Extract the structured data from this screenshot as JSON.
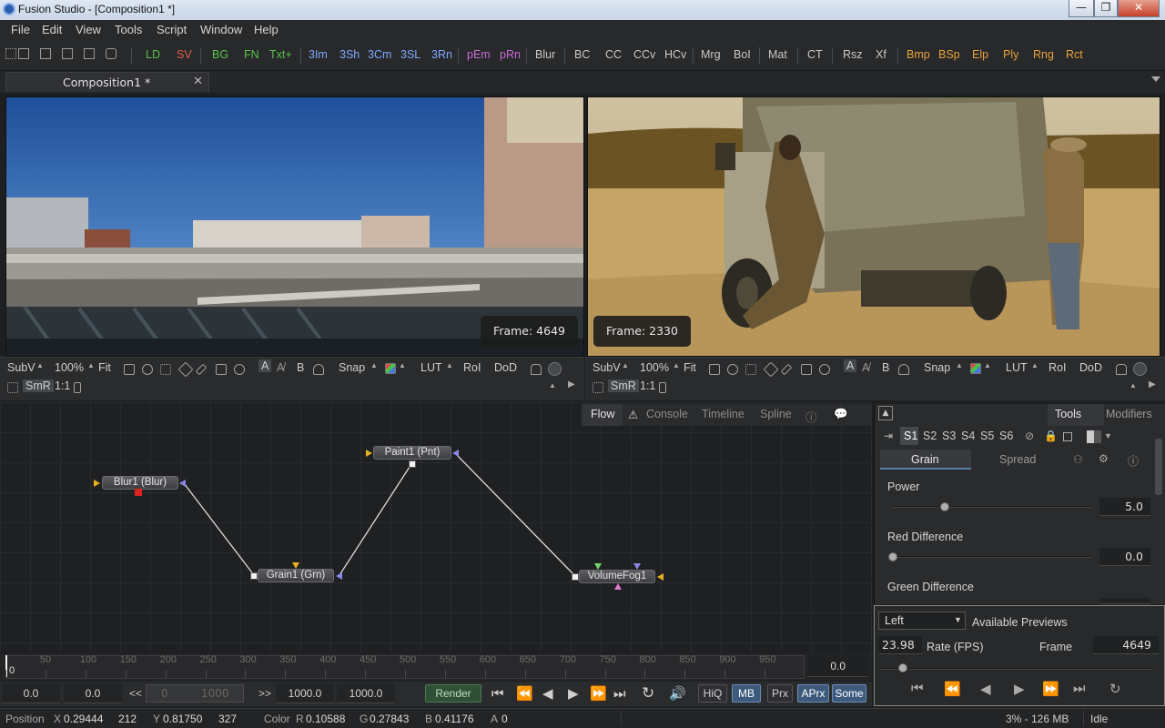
{
  "window": {
    "title": "Fusion Studio - [Composition1 *]",
    "min": "—",
    "max": "❐",
    "close": "✕"
  },
  "menu": [
    "File",
    "Edit",
    "View",
    "Tools",
    "Script",
    "Window",
    "Help"
  ],
  "toolbar": {
    "group1": [
      "LD",
      "SV"
    ],
    "group2": [
      "BG",
      "FN",
      "Txt+"
    ],
    "group3": [
      "3Im",
      "3Sh",
      "3Cm",
      "3SL",
      "3Rn"
    ],
    "group4": [
      "pEm",
      "pRn"
    ],
    "group5": [
      "Blur",
      "BC",
      "CC",
      "CCv",
      "HCv",
      "Mrg",
      "BoI",
      "Mat",
      "CT",
      "Rsz",
      "Xf"
    ],
    "group6": [
      "Bmp",
      "BSp",
      "Elp",
      "Ply",
      "Rng",
      "Rct"
    ],
    "colors": {
      "green": "#57c24a",
      "red": "#e0604a",
      "purple": "#c86bd8",
      "blue": "#7fa8ff",
      "orange": "#e8a23c"
    }
  },
  "tabs": {
    "composition": "Composition1 *",
    "close": "✕"
  },
  "viewers": {
    "left": {
      "frame": "Frame: 4649"
    },
    "right": {
      "frame": "Frame: 2330"
    },
    "bar": {
      "subv": "SubV",
      "zoom": "100%",
      "fit": "Fit",
      "snap": "Snap",
      "lut": "LUT",
      "roi": "RoI",
      "dod": "DoD",
      "smr": "SmR",
      "ratio": "1:1",
      "b": "B"
    }
  },
  "flow_tabs": [
    "Flow",
    "Console",
    "Timeline",
    "Spline"
  ],
  "nodes": [
    {
      "label": "Blur1  (Blur)"
    },
    {
      "label": "Paint1  (Pnt)"
    },
    {
      "label": "Grain1  (Grn)"
    },
    {
      "label": "VolumeFog1"
    }
  ],
  "inspector": {
    "tabs": [
      "Tools",
      "Modifiers"
    ],
    "slots": [
      "S1",
      "S2",
      "S3",
      "S4",
      "S5",
      "S6"
    ],
    "subtabs": [
      "Grain",
      "Spread"
    ],
    "params": [
      {
        "label": "Power",
        "value": "5.0",
        "fraction": 0.26
      },
      {
        "label": "Red Difference",
        "value": "0.0",
        "fraction": 0.0
      },
      {
        "label": "Green Difference",
        "value": ""
      }
    ]
  },
  "preview": {
    "select": "Left",
    "available": "Available Previews",
    "rate_value": "23.98",
    "rate_label": "Rate (FPS)",
    "frame_label": "Frame",
    "frame_value": "4649"
  },
  "timeline": {
    "ticks": [
      "0",
      "50",
      "100",
      "150",
      "200",
      "250",
      "300",
      "350",
      "400",
      "450",
      "500",
      "550",
      "600",
      "650",
      "700",
      "750",
      "800",
      "850",
      "900",
      "950"
    ],
    "current": "0.0"
  },
  "transport": {
    "start": "0.0",
    "render_start": "0.0",
    "back": "<<",
    "range_lo": "0",
    "range_hi": "1000",
    "fwd": ">>",
    "render_end": "1000.0",
    "end": "1000.0",
    "render": "Render",
    "toggles": [
      "HiQ",
      "MB",
      "Prx",
      "APrx",
      "Some"
    ]
  },
  "status": {
    "position_label": "Position",
    "x_label": "X",
    "x": "0.29444",
    "px": "212",
    "y_label": "Y",
    "y": "0.81750",
    "py": "327",
    "color_label": "Color",
    "r_label": "R",
    "r": "0.10588",
    "g_label": "G",
    "g": "0.27843",
    "b_label": "B",
    "b": "0.41176",
    "a_label": "A",
    "a": "0",
    "memory": "3% - 126 MB",
    "state": "Idle"
  }
}
